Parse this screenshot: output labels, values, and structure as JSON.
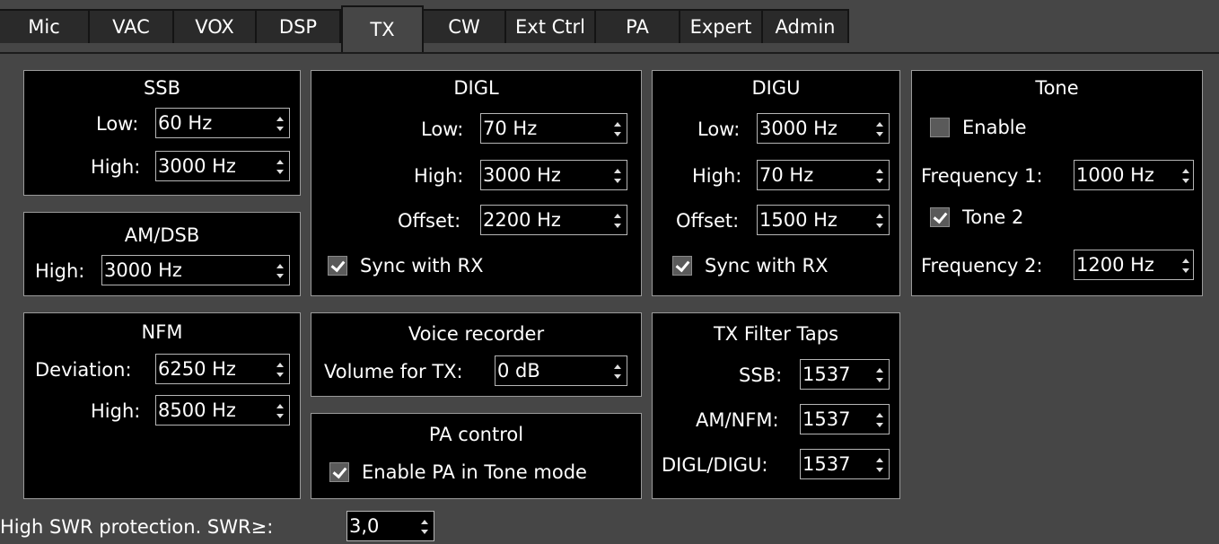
{
  "tabs": [
    "Mic",
    "VAC",
    "VOX",
    "DSP",
    "TX",
    "CW",
    "Ext Ctrl",
    "PA",
    "Expert",
    "Admin"
  ],
  "active_tab": "TX",
  "ssb": {
    "title": "SSB",
    "low_label": "Low:",
    "low_value": "60 Hz",
    "high_label": "High:",
    "high_value": "3000 Hz"
  },
  "amdsb": {
    "title": "AM/DSB",
    "high_label": "High:",
    "high_value": "3000 Hz"
  },
  "nfm": {
    "title": "NFM",
    "deviation_label": "Deviation:",
    "deviation_value": "6250 Hz",
    "high_label": "High:",
    "high_value": "8500 Hz"
  },
  "digl": {
    "title": "DIGL",
    "low_label": "Low:",
    "low_value": "70 Hz",
    "high_label": "High:",
    "high_value": "3000 Hz",
    "offset_label": "Offset:",
    "offset_value": "2200 Hz",
    "sync_label": "Sync with RX",
    "sync_checked": true
  },
  "digu": {
    "title": "DIGU",
    "low_label": "Low:",
    "low_value": "3000 Hz",
    "high_label": "High:",
    "high_value": "70 Hz",
    "offset_label": "Offset:",
    "offset_value": "1500 Hz",
    "sync_label": "Sync with RX",
    "sync_checked": true
  },
  "tone": {
    "title": "Tone",
    "enable_label": "Enable",
    "enable_checked": false,
    "freq1_label": "Frequency 1:",
    "freq1_value": "1000 Hz",
    "tone2_label": "Tone 2",
    "tone2_checked": true,
    "freq2_label": "Frequency 2:",
    "freq2_value": "1200 Hz"
  },
  "voice": {
    "title": "Voice recorder",
    "volume_label": "Volume for TX:",
    "volume_value": "0 dB"
  },
  "pa": {
    "title": "PA control",
    "enable_label": "Enable PA in Tone mode",
    "enable_checked": true
  },
  "taps": {
    "title": "TX Filter Taps",
    "ssb_label": "SSB:",
    "ssb_value": "1537",
    "amnfm_label": "AM/NFM:",
    "amnfm_value": "1537",
    "digl_label": "DIGL/DIGU:",
    "digl_value": "1537"
  },
  "swr": {
    "label": "High SWR protection. SWR≥:",
    "value": "3,0"
  },
  "colors": {
    "background": "#464646",
    "panel": "#000000",
    "tab": "#2a2a2a",
    "border": "#9a9a9a"
  }
}
